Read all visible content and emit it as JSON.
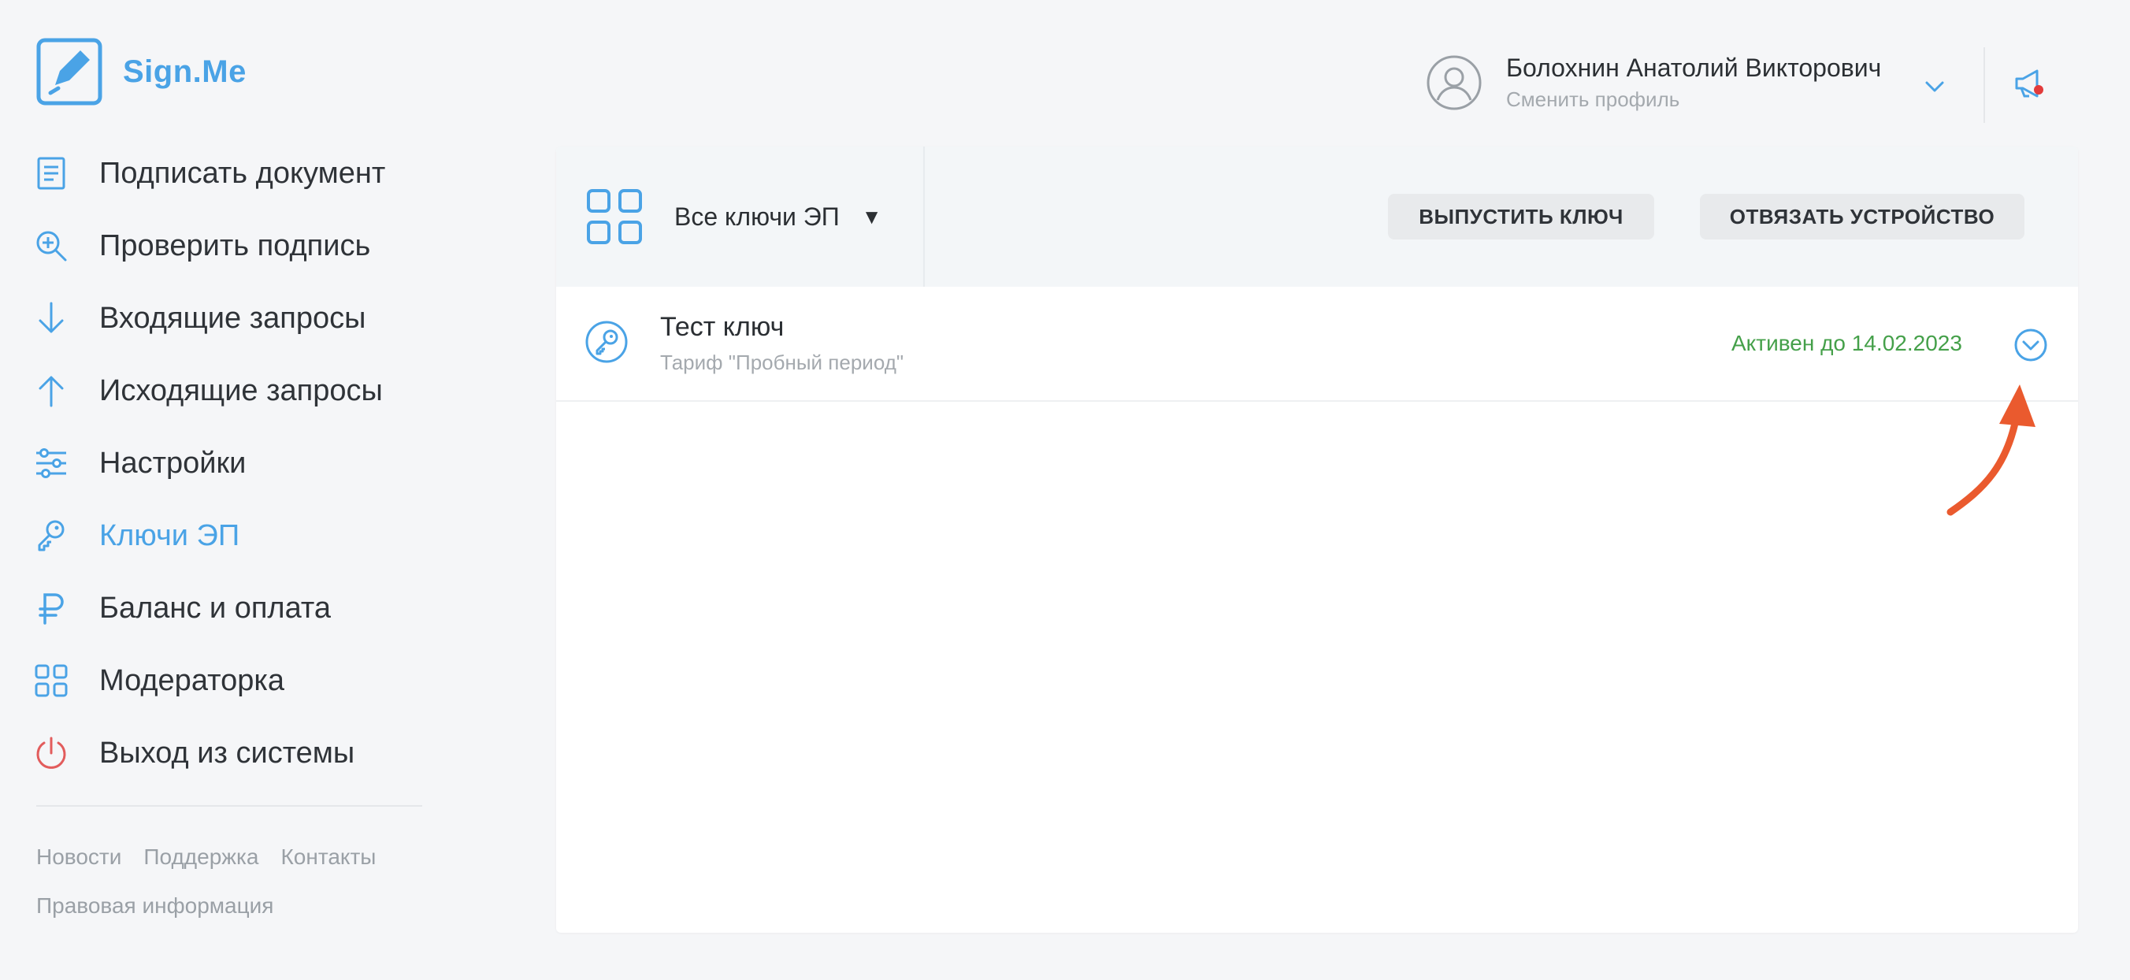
{
  "brand": {
    "name": "Sign.Me"
  },
  "sidebar": {
    "items": [
      {
        "label": "Подписать документ",
        "icon": "document-icon"
      },
      {
        "label": "Проверить подпись",
        "icon": "zoom-check-icon"
      },
      {
        "label": "Входящие запросы",
        "icon": "arrow-down-icon"
      },
      {
        "label": "Исходящие запросы",
        "icon": "arrow-up-icon"
      },
      {
        "label": "Настройки",
        "icon": "sliders-icon"
      },
      {
        "label": "Ключи ЭП",
        "icon": "key-icon",
        "active": true
      },
      {
        "label": "Баланс и оплата",
        "icon": "ruble-icon"
      },
      {
        "label": "Модераторка",
        "icon": "grid-icon"
      },
      {
        "label": "Выход из системы",
        "icon": "power-icon"
      }
    ],
    "footer_links": [
      "Новости",
      "Поддержка",
      "Контакты",
      "Правовая информация"
    ]
  },
  "header": {
    "user_name": "Болохнин Анатолий Викторович",
    "switch_profile": "Сменить профиль"
  },
  "toolbar": {
    "filter_label": "Все ключи ЭП",
    "filter_caret": "▼",
    "issue_key_button": "ВЫПУСТИТЬ КЛЮЧ",
    "unbind_device_button": "ОТВЯЗАТЬ УСТРОЙСТВО"
  },
  "keys": [
    {
      "name": "Тест ключ",
      "tariff": "Тариф \"Пробный период\"",
      "status": "Активен до 14.02.2023"
    }
  ],
  "colors": {
    "accent": "#4aa3e6",
    "active_green": "#45a04a",
    "logout_red": "#e25c5c",
    "annotation_arrow": "#ea5a2e"
  }
}
